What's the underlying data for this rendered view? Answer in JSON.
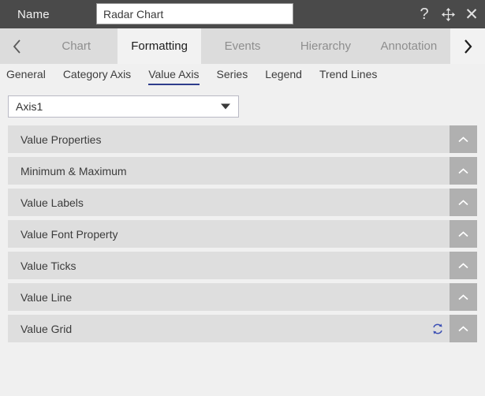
{
  "titlebar": {
    "label": "Name",
    "name_value": "Radar Chart",
    "name_placeholder": "Name",
    "help_icon": "question-mark-icon",
    "move_icon": "move-cross-arrows-icon",
    "close_icon": "close-x-icon"
  },
  "tabstrip": {
    "prev_icon": "chevron-left-icon",
    "next_icon": "chevron-right-icon",
    "tabs": [
      {
        "label": "Chart",
        "active": false
      },
      {
        "label": "Formatting",
        "active": true
      },
      {
        "label": "Events",
        "active": false
      },
      {
        "label": "Hierarchy",
        "active": false
      },
      {
        "label": "Annotation",
        "active": false
      }
    ]
  },
  "subtabs": {
    "items": [
      {
        "label": "General",
        "active": false
      },
      {
        "label": "Category Axis",
        "active": false
      },
      {
        "label": "Value Axis",
        "active": true
      },
      {
        "label": "Series",
        "active": false
      },
      {
        "label": "Legend",
        "active": false
      },
      {
        "label": "Trend Lines",
        "active": false
      }
    ],
    "active_underline_color": "#2f3d8c"
  },
  "axis_selector": {
    "value": "Axis1",
    "caret_icon": "chevron-down-filled-icon"
  },
  "panels": {
    "toggle_icon": "chevron-up-icon",
    "reset_icon": "refresh-sync-icon",
    "items": [
      {
        "title": "Value Properties",
        "has_reset": false
      },
      {
        "title": "Minimum & Maximum",
        "has_reset": false
      },
      {
        "title": "Value Labels",
        "has_reset": false
      },
      {
        "title": "Value Font Property",
        "has_reset": false
      },
      {
        "title": "Value Ticks",
        "has_reset": false
      },
      {
        "title": "Value Line",
        "has_reset": false
      },
      {
        "title": "Value Grid",
        "has_reset": true
      }
    ]
  },
  "colors": {
    "titlebar_bg": "#4a4a4a",
    "tabstrip_bg": "#dcdcdc",
    "active_tab_bg": "#f2f2f2",
    "panel_bg": "#dedede",
    "panel_toggle_bg": "#b0b0b0",
    "accent": "#2f3d8c",
    "reset_icon_color": "#3c50b4",
    "page_bg": "#f0f0f0"
  }
}
